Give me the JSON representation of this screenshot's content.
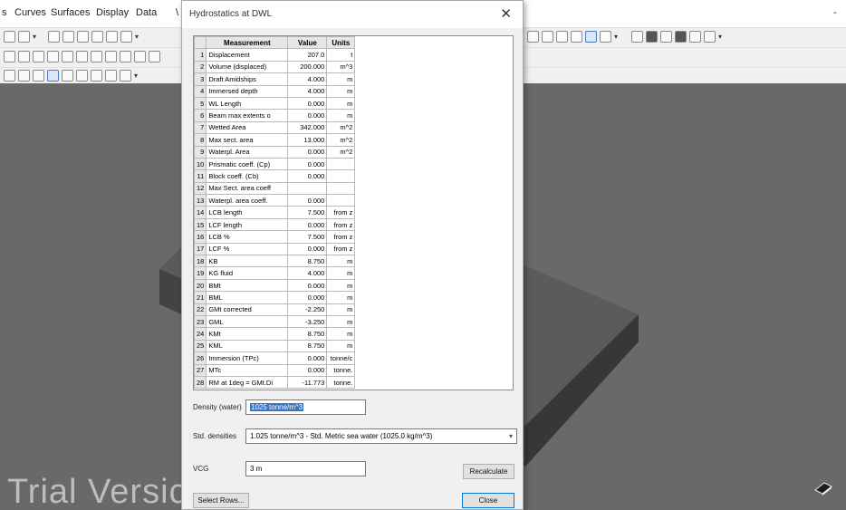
{
  "menubar": {
    "items": [
      "s",
      "Curves",
      "Surfaces",
      "Display",
      "Data",
      "\\"
    ],
    "right_mark": "-"
  },
  "dialog": {
    "title": "Hydrostatics at DWL",
    "close_glyph": "✕",
    "columns": [
      "Measurement",
      "Value",
      "Units"
    ],
    "rows": [
      {
        "n": "1",
        "name": "Displacement",
        "value": "207.0",
        "unit": "t"
      },
      {
        "n": "2",
        "name": "Volume (displaced)",
        "value": "200.000",
        "unit": "m^3"
      },
      {
        "n": "3",
        "name": "Draft Amidships",
        "value": "4.000",
        "unit": "m"
      },
      {
        "n": "4",
        "name": "Immersed depth",
        "value": "4.000",
        "unit": "m"
      },
      {
        "n": "5",
        "name": "WL Length",
        "value": "0.000",
        "unit": "m"
      },
      {
        "n": "6",
        "name": "Beam max extents o",
        "value": "0.000",
        "unit": "m"
      },
      {
        "n": "7",
        "name": "Wetted Area",
        "value": "342.000",
        "unit": "m^2"
      },
      {
        "n": "8",
        "name": "Max sect. area",
        "value": "13.000",
        "unit": "m^2"
      },
      {
        "n": "9",
        "name": "Waterpl. Area",
        "value": "0.000",
        "unit": "m^2"
      },
      {
        "n": "10",
        "name": "Prismatic coeff. (Cp)",
        "value": "0.000",
        "unit": ""
      },
      {
        "n": "11",
        "name": "Block coeff. (Cb)",
        "value": "0.000",
        "unit": ""
      },
      {
        "n": "12",
        "name": "Max Sect. area coeff",
        "value": "",
        "unit": ""
      },
      {
        "n": "13",
        "name": "Waterpl. area coeff.",
        "value": "0.000",
        "unit": ""
      },
      {
        "n": "14",
        "name": "LCB length",
        "value": "7.500",
        "unit": "from z"
      },
      {
        "n": "15",
        "name": "LCF length",
        "value": "0.000",
        "unit": "from z"
      },
      {
        "n": "16",
        "name": "LCB %",
        "value": "7.500",
        "unit": "from z"
      },
      {
        "n": "17",
        "name": "LCF %",
        "value": "0.000",
        "unit": "from z"
      },
      {
        "n": "18",
        "name": "KB",
        "value": "8.750",
        "unit": "m"
      },
      {
        "n": "19",
        "name": "KG fluid",
        "value": "4.000",
        "unit": "m"
      },
      {
        "n": "20",
        "name": "BMt",
        "value": "0.000",
        "unit": "m"
      },
      {
        "n": "21",
        "name": "BML",
        "value": "0.000",
        "unit": "m"
      },
      {
        "n": "22",
        "name": "GMt corrected",
        "value": "-2.250",
        "unit": "m"
      },
      {
        "n": "23",
        "name": "GML",
        "value": "-3.250",
        "unit": "m"
      },
      {
        "n": "24",
        "name": "KMt",
        "value": "8.750",
        "unit": "m"
      },
      {
        "n": "25",
        "name": "KML",
        "value": "8.750",
        "unit": "m"
      },
      {
        "n": "26",
        "name": "Immersion (TPc)",
        "value": "0.000",
        "unit": "tonne/c"
      },
      {
        "n": "27",
        "name": "MTc",
        "value": "0.000",
        "unit": "tonne."
      },
      {
        "n": "28",
        "name": "RM at 1deg = GMt.Di",
        "value": "-11.773",
        "unit": "tonne."
      }
    ],
    "density_label": "Density (water)",
    "density_value": "1025 tonne/m^3",
    "std_label": "Std. densities",
    "std_value": "1.025 tonne/m^3 - Std. Metric sea water (1025.0 kg/m^3)",
    "vcg_label": "VCG",
    "vcg_value": "3 m",
    "recalc_label": "Recalculate",
    "select_rows_label": "Select Rows...",
    "close_label": "Close"
  },
  "viewport": {
    "watermark": "Trial Versic"
  },
  "colors": {
    "viewport_bg": "#696969",
    "box_top": "#5b5b5b",
    "box_side": "#3f3f3f",
    "selection": "#3a75c4"
  }
}
